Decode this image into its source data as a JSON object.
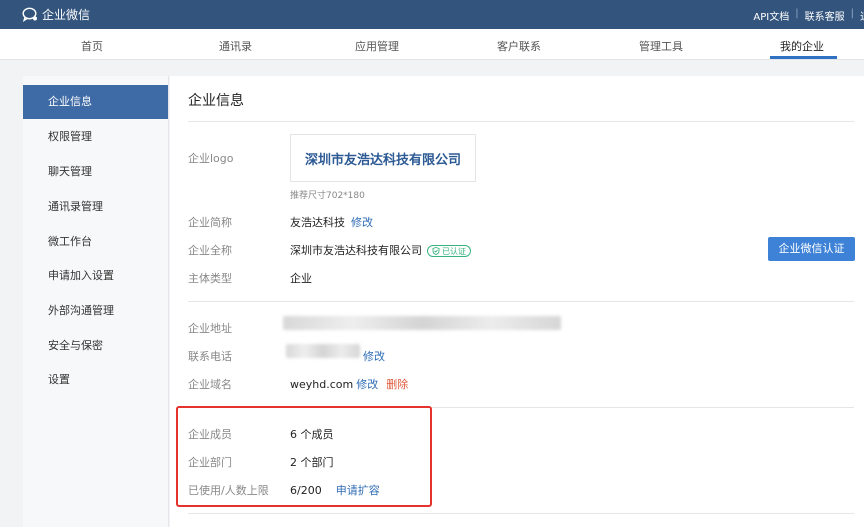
{
  "app": {
    "title": "企业微信"
  },
  "top_links": {
    "api_docs": "API文档",
    "contact_support": "联系客服",
    "logout": "退"
  },
  "nav": {
    "tabs": [
      "首页",
      "通讯录",
      "应用管理",
      "客户联系",
      "管理工具",
      "我的企业"
    ],
    "active": "我的企业"
  },
  "sidebar": {
    "items": [
      "企业信息",
      "权限管理",
      "聊天管理",
      "通讯录管理",
      "微工作台",
      "申请加入设置",
      "外部沟通管理",
      "安全与保密",
      "设置"
    ],
    "active": "企业信息"
  },
  "main": {
    "title": "企业信息",
    "logo": {
      "label": "企业logo",
      "text": "深圳市友浩达科技有限公司",
      "hint": "推荐尺寸702*180"
    },
    "short_name": {
      "label": "企业简称",
      "value": "友浩达科技",
      "edit": "修改"
    },
    "full_name": {
      "label": "企业全称",
      "value": "深圳市友浩达科技有限公司",
      "badge": "已认证"
    },
    "entity_type": {
      "label": "主体类型",
      "value": "企业"
    },
    "cert_button": "企业微信认证",
    "address": {
      "label": "企业地址"
    },
    "phone": {
      "label": "联系电话",
      "edit": "修改"
    },
    "domain": {
      "label": "企业域名",
      "value": "weyhd.com",
      "edit": "修改",
      "delete": "删除"
    },
    "members": {
      "label": "企业成员",
      "value": "6 个成员"
    },
    "departments": {
      "label": "企业部门",
      "value": "2 个部门"
    },
    "capacity": {
      "label": "已使用/人数上限",
      "value": "6/200",
      "action": "申请扩容"
    }
  },
  "colors": {
    "topbar": "#33557d",
    "accent": "#2f72c4",
    "sidebar_active": "#3e6aa5",
    "button": "#3d82d6",
    "verified": "#36b37e",
    "delete": "#e0593a",
    "highlight": "#e5322d"
  }
}
